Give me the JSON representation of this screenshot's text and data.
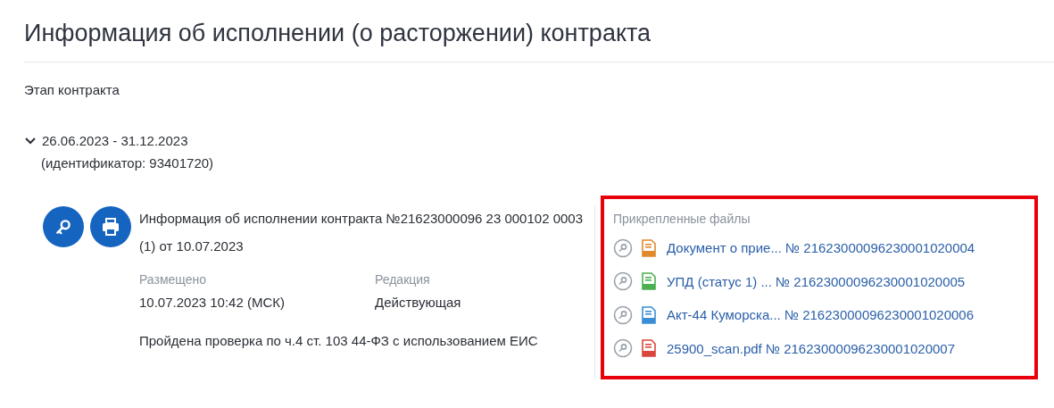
{
  "page_title": "Информация об исполнении (о расторжении) контракта",
  "section_label": "Этап контракта",
  "stage": {
    "expanded": true,
    "dates": "26.06.2023 - 31.12.2023",
    "identifier": "(идентификатор: 93401720)"
  },
  "document": {
    "title": "Информация об исполнении контракта №21623000096 23 000102 0003 (1) от 10.07.2023",
    "fields": [
      {
        "label": "Размещено",
        "value": "10.07.2023 10:42 (МСК)"
      },
      {
        "label": "Редакция",
        "value": "Действующая"
      }
    ],
    "note": "Пройдена проверка по ч.4 ст. 103 44-ФЗ с использованием ЕИС"
  },
  "attachments": {
    "highlighted": true,
    "title": "Прикрепленные файлы",
    "files": [
      {
        "kind": "zip",
        "name": "Документ о прие... № 21623000096230001020004"
      },
      {
        "kind": "xlsx",
        "name": "УПД (статус 1) ... № 21623000096230001020005"
      },
      {
        "kind": "doc",
        "name": "Акт-44 Куморска... № 21623000096230001020006"
      },
      {
        "kind": "pdf",
        "name": "25900_scan.pdf № 21623000096230001020007"
      }
    ]
  }
}
